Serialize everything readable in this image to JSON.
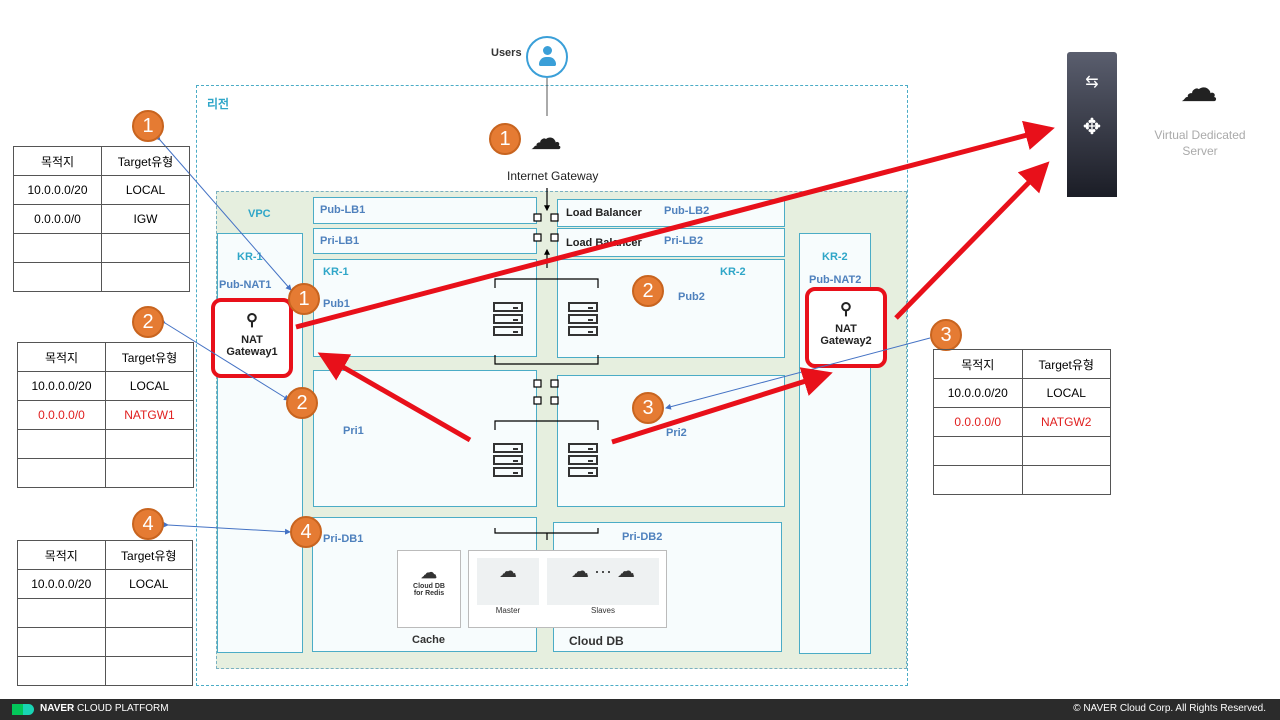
{
  "region_label": "리전",
  "users_label": "Users",
  "igw_label": "Internet Gateway",
  "vpc_label": "VPC",
  "zones": {
    "kr1": "KR-1",
    "kr2": "KR-2"
  },
  "subnets": {
    "pub_nat1": "Pub-NAT1",
    "pub_nat2": "Pub-NAT2",
    "pub_lb1": "Pub-LB1",
    "pri_lb1": "Pri-LB1",
    "pub_lb2": "Pub-LB2",
    "pri_lb2": "Pri-LB2",
    "pub1": "Pub1",
    "pub2": "Pub2",
    "pri1": "Pri1",
    "pri2": "Pri2",
    "pri_db1": "Pri-DB1",
    "pri_db2": "Pri-DB2"
  },
  "load_balancer": "Load Balancer",
  "nat1": [
    "NAT",
    "Gateway1"
  ],
  "nat2": [
    "NAT",
    "Gateway2"
  ],
  "db": {
    "redis": [
      "Cloud DB",
      "for Redis"
    ],
    "cache": "Cache",
    "master": "Master",
    "slaves": "Slaves",
    "cloud_db": "Cloud DB"
  },
  "vds_label": [
    "Virtual Dedicated",
    "Server"
  ],
  "badges": [
    "1",
    "2",
    "4",
    "1",
    "2",
    "4",
    "2",
    "3",
    "3",
    "1"
  ],
  "route_tables": [
    {
      "headers": [
        "목적지",
        "Target유형"
      ],
      "rows": [
        [
          "10.0.0.0/20",
          "LOCAL"
        ],
        [
          "0.0.0.0/0",
          "IGW"
        ],
        [
          "",
          ""
        ],
        [
          "",
          ""
        ]
      ]
    },
    {
      "headers": [
        "목적지",
        "Target유형"
      ],
      "rows": [
        [
          "10.0.0.0/20",
          "LOCAL"
        ],
        [
          "0.0.0.0/0",
          "NATGW1"
        ],
        [
          "",
          ""
        ],
        [
          "",
          ""
        ]
      ],
      "highlight_row": 1
    },
    {
      "headers": [
        "목적지",
        "Target유형"
      ],
      "rows": [
        [
          "10.0.0.0/20",
          "LOCAL"
        ],
        [
          "",
          ""
        ],
        [
          "",
          ""
        ],
        [
          "",
          ""
        ]
      ]
    },
    {
      "headers": [
        "목적지",
        "Target유형"
      ],
      "rows": [
        [
          "10.0.0.0/20",
          "LOCAL"
        ],
        [
          "0.0.0.0/0",
          "NATGW2"
        ],
        [
          "",
          ""
        ],
        [
          "",
          ""
        ]
      ],
      "highlight_row": 1
    }
  ],
  "footer": {
    "brand_bold": "NAVER",
    "brand": " CLOUD PLATFORM",
    "copyright": "© NAVER Cloud Corp. All Rights Reserved."
  },
  "colors": {
    "badge": "#e57b33",
    "highlight": "#e8101a",
    "vpc_bg": "#e6efdf",
    "subnet_border": "#4bacc6"
  }
}
